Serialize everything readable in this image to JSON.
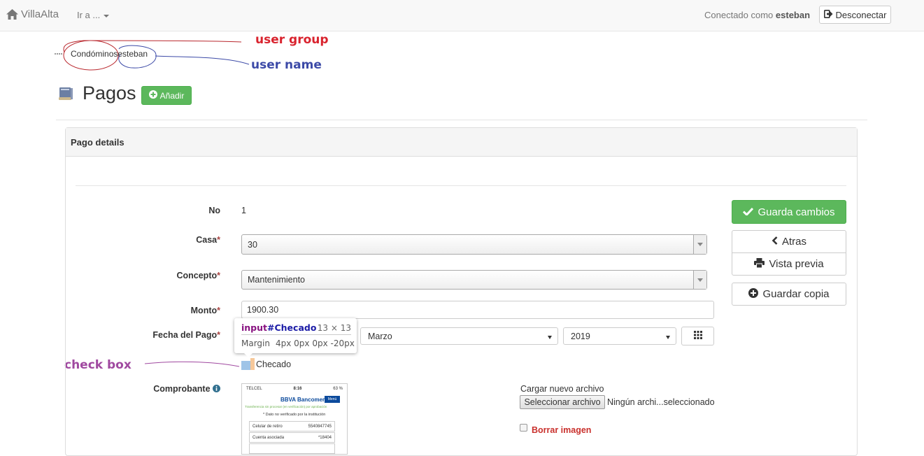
{
  "navbar": {
    "brand": "VillaAlta",
    "menu": "Ir a ...",
    "logged_prefix": "Conectado como",
    "logged_user": "esteban",
    "logout": "Desconectar"
  },
  "annotations": {
    "user_group": "user group",
    "user_name": "user name",
    "check_box": "check box",
    "colors": {
      "group": "#d9232e",
      "name": "#3c4aa7",
      "check": "#a049a0"
    }
  },
  "user_line": {
    "group": "Condóminos",
    "name": "esteban"
  },
  "header": {
    "title": "Pagos",
    "add_label": "Añadir"
  },
  "panel": {
    "title": "Pago details"
  },
  "form": {
    "no": {
      "label": "No",
      "value": "1"
    },
    "casa": {
      "label": "Casa",
      "value": "30"
    },
    "concepto": {
      "label": "Concepto",
      "value": "Mantenimiento"
    },
    "monto": {
      "label": "Monto",
      "value": "1900.30"
    },
    "fecha": {
      "label": "Fecha del Pago",
      "month": "Marzo",
      "year": "2019"
    },
    "checado": {
      "label": "Checado"
    },
    "comprobante": {
      "label": "Comprobante"
    },
    "required_mark": "*"
  },
  "upload": {
    "label": "Cargar nuevo archivo",
    "button": "Seleccionar archivo",
    "status": "Ningún archi...seleccionado",
    "delete_label": "Borrar imagen"
  },
  "actions": {
    "save": "Guarda cambios",
    "back": "Atras",
    "preview": "Vista previa",
    "save_copy": "Guardar copia"
  },
  "inspector": {
    "tag": "input",
    "id": "#Checado",
    "size": "13 × 13",
    "margin_label": "Margin",
    "margin_value": "4px 0px 0px -20px"
  },
  "receipt": {
    "carrier": "TELCEL",
    "time": "8:16",
    "battery": "63 %",
    "bank": "BBVA Bancomer",
    "menu": "Menú",
    "tagline": "Transferencia sin procesar (en verificación) por aprobación",
    "note": "* Dato no verificado por la institución",
    "rows": [
      {
        "label": "Celular de retiro",
        "value": "5540847745"
      },
      {
        "label": "Cuenta asociada",
        "value": "*18404"
      }
    ]
  },
  "colors": {
    "green": "#5cb85c",
    "danger": "#c9302c",
    "required": "#a94442"
  }
}
